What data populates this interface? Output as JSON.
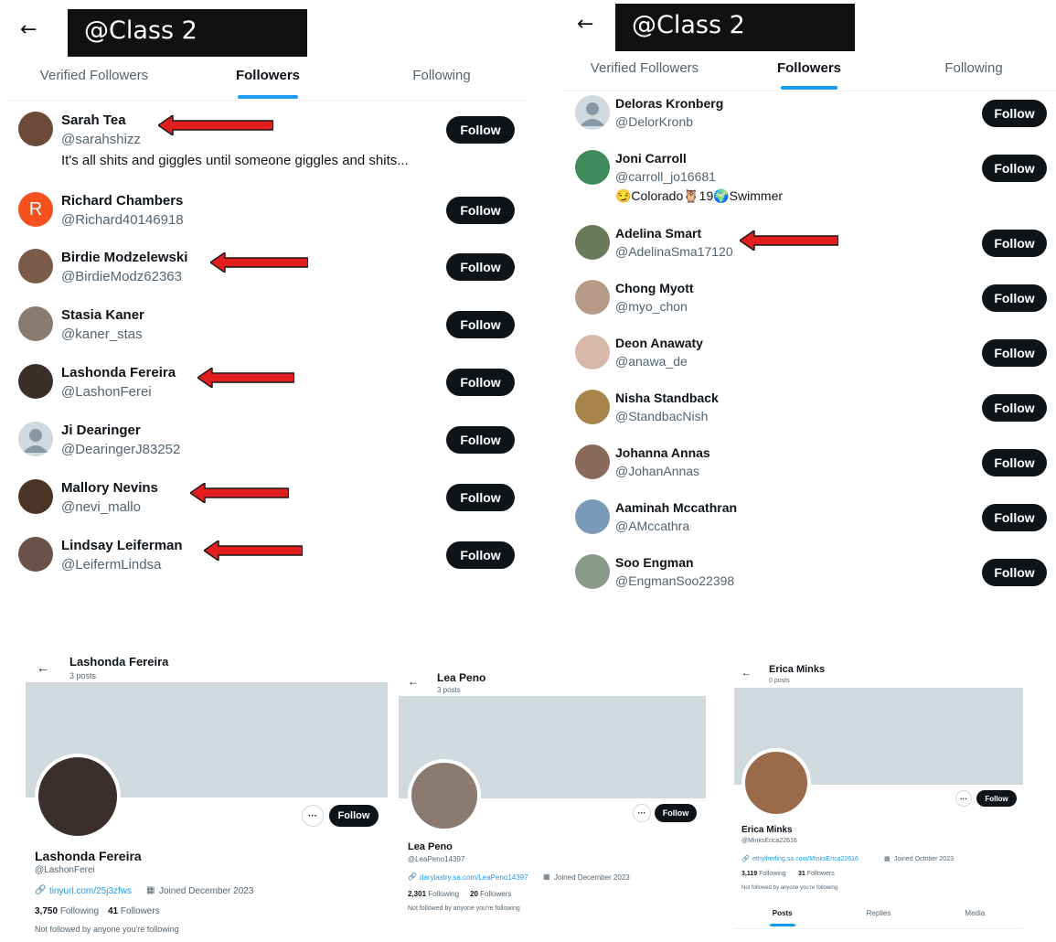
{
  "panel_left": {
    "title": "@Class 2",
    "tabs": [
      "Verified Followers",
      "Followers",
      "Following"
    ],
    "users": [
      {
        "name": "Sarah Tea",
        "handle": "@sarahshizz",
        "bio": "It's all shits and giggles until someone giggles and shits...",
        "follow": "Follow",
        "avatar_color": "#6b4a3a"
      },
      {
        "name": "Richard Chambers",
        "handle": "@Richard40146918",
        "follow": "Follow",
        "avatar_letter": "R",
        "avatar_color": "#f4511e"
      },
      {
        "name": "Birdie Modzelewski",
        "handle": "@BirdieModz62363",
        "follow": "Follow",
        "avatar_color": "#7a5a48"
      },
      {
        "name": "Stasia Kaner",
        "handle": "@kaner_stas",
        "follow": "Follow",
        "avatar_color": "#8a7b70"
      },
      {
        "name": "Lashonda Fereira",
        "handle": "@LashonFerei",
        "follow": "Follow",
        "avatar_color": "#3a2e2a"
      },
      {
        "name": "Ji Dearinger",
        "handle": "@DearingerJ83252",
        "follow": "Follow",
        "avatar_color": "#cfd9de"
      },
      {
        "name": "Mallory Nevins",
        "handle": "@nevi_mallo",
        "follow": "Follow",
        "avatar_color": "#4a3426"
      },
      {
        "name": "Lindsay Leiferman",
        "handle": "@LeifermLindsa",
        "follow": "Follow",
        "avatar_color": "#6a5248"
      }
    ]
  },
  "panel_right": {
    "title": "@Class 2",
    "tabs": [
      "Verified Followers",
      "Followers",
      "Following"
    ],
    "users": [
      {
        "name": "Deloras Kronberg",
        "handle": "@DelorKronb",
        "follow": "Follow",
        "avatar_color": "#cfd9de"
      },
      {
        "name": "Joni Carroll",
        "handle": "@carroll_jo16681",
        "bio": "😏Colorado🦉19🌍Swimmer",
        "follow": "Follow",
        "avatar_color": "#3e8a5a"
      },
      {
        "name": "Adelina Smart",
        "handle": "@AdelinaSma17120",
        "follow": "Follow",
        "avatar_color": "#6a7a5a"
      },
      {
        "name": "Chong Myott",
        "handle": "@myo_chon",
        "follow": "Follow",
        "avatar_color": "#b89a88"
      },
      {
        "name": "Deon Anawaty",
        "handle": "@anawa_de",
        "follow": "Follow",
        "avatar_color": "#d8b8a8"
      },
      {
        "name": "Nisha Standback",
        "handle": "@StandbacNish",
        "follow": "Follow",
        "avatar_color": "#a8844a"
      },
      {
        "name": "Johanna Annas",
        "handle": "@JohanAnnas",
        "follow": "Follow",
        "avatar_color": "#8a6a5a"
      },
      {
        "name": "Aaminah Mccathran",
        "handle": "@AMccathra",
        "follow": "Follow",
        "avatar_color": "#7a9ab8"
      },
      {
        "name": "Soo Engman",
        "handle": "@EngmanSoo22398",
        "follow": "Follow",
        "avatar_color": "#8a9a8a"
      }
    ]
  },
  "profiles": [
    {
      "header_name": "Lashonda Fereira",
      "posts": "3 posts",
      "name": "Lashonda Fereira",
      "handle": "@LashonFerei",
      "link": "tinyurl.com/25j3zfws",
      "joined": "Joined December 2023",
      "following_count": "3,750",
      "following_label": "Following",
      "followers_count": "41",
      "followers_label": "Followers",
      "not_followed": "Not followed by anyone you're following",
      "follow": "Follow",
      "dots": "···",
      "avatar_color": "#3a2f2c"
    },
    {
      "header_name": "Lea Peno",
      "posts": "3 posts",
      "name": "Lea Peno",
      "handle": "@LeaPeno14397",
      "link": "darylastry.sa.com/LeaPeno14397",
      "joined": "Joined December 2023",
      "following_count": "2,301",
      "following_label": "Following",
      "followers_count": "20",
      "followers_label": "Followers",
      "not_followed": "Not followed by anyone you're following",
      "follow": "Follow",
      "dots": "···",
      "avatar_color": "#8a7a70"
    },
    {
      "header_name": "Erica Minks",
      "posts": "0 posts",
      "name": "Erica Minks",
      "handle": "@MinksErica22616",
      "link": "ethylherling.sa.com/MinksErica22616",
      "joined": "Joined October 2023",
      "following_count": "3,119",
      "following_label": "Following",
      "followers_count": "31",
      "followers_label": "Followers",
      "not_followed": "Not followed by anyone you're following",
      "follow": "Follow",
      "dots": "···",
      "tabs": [
        "Posts",
        "Replies",
        "Media"
      ],
      "avatar_color": "#9a6a4a"
    }
  ],
  "colors": {
    "accent": "#1d9bf0",
    "arrow_red": "#e11d1d",
    "banner": "#cfd9de"
  }
}
